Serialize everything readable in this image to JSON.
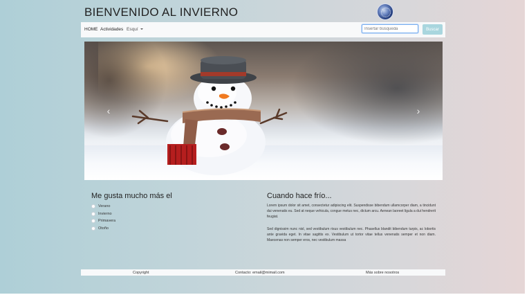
{
  "header": {
    "title": "BIENVENIDO AL INVIERNO",
    "logo_icon": "globe-logo-icon"
  },
  "nav": {
    "home": "HOME",
    "activities": "Actividades",
    "ski": "Esquí",
    "search_placeholder": "Insertar búsqueda",
    "search_button": "Buscar"
  },
  "carousel": {
    "image_alt": "Muñeco de nieve con sombrero y bufanda",
    "prev_icon": "chevron-left-icon",
    "next_icon": "chevron-right-icon"
  },
  "left_section": {
    "title": "Me gusta mucho más el",
    "options": [
      "Verano",
      "Invierno",
      "Primavera",
      "Otoño"
    ]
  },
  "right_section": {
    "title": "Cuando hace frío...",
    "paragraph_1": "Lorem ipsum dolor sit amet, consectetur adipiscing elit. Suspendisse bibendum ullamcorper diam, a tincidunt dui venenatis eu. Sed at neque vehicula, congue metus nec, dictum arcu. Aenean laoreet ligula a dui hendrerit feugiat.",
    "paragraph_2": "Sed dignissim nunc nisl, sed vestibulum risus vestibulum nec. Phasellus blandit bibendum turpis, ac lobortis ante gravida eget. In vitae sagittis ex. Vestibulum ut tortor vitae tellus venenatis semper et non diam. Maecenas non semper eros, nec vestibulum massa"
  },
  "footer": {
    "copyright": "Copyright",
    "contact": "Contacto: email@mimail.com",
    "about": "Más sobre nosotros"
  },
  "colors": {
    "search_button_bg": "#a9d6de",
    "navbar_bg": "#f8f9fa"
  }
}
